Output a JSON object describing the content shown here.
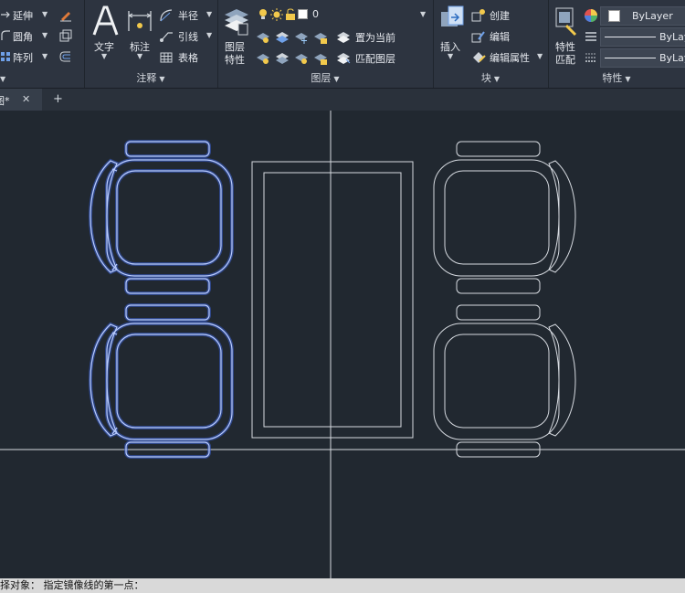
{
  "modify_panel": {
    "stretch_label": "延伸",
    "fillet_label": "圆角",
    "array_label": "阵列"
  },
  "annotation_panel": {
    "title": "注释",
    "text_label": "文字",
    "dimension_label": "标注",
    "radius_label": "半径",
    "leader_label": "引线",
    "table_label": "表格"
  },
  "layers_panel": {
    "title": "图层",
    "layer_props_label": "图层\n特性",
    "layer_props_line1": "图层",
    "layer_props_line2": "特性",
    "current_layer": "0",
    "make_current_label": "置为当前",
    "match_layer_label": "匹配图层"
  },
  "block_panel": {
    "title": "块",
    "insert_label": "插入",
    "create_label": "创建",
    "edit_label": "编辑",
    "edit_attr_label": "编辑属性"
  },
  "properties_panel": {
    "title": "特性",
    "match_line1": "特性",
    "match_line2": "匹配",
    "color_value": "ByLayer",
    "linetype_value": "ByLay",
    "lineweight_value": "ByLay"
  },
  "tabs": {
    "drawing_tab": "图*",
    "close_symbol": "✕",
    "new_tab_symbol": "+"
  },
  "command_line": {
    "text": "择对象：  指定镜像线的第一点："
  },
  "colors": {
    "selected": "#6f98ff",
    "drawing": "#d6dae0",
    "background": "#212830"
  }
}
